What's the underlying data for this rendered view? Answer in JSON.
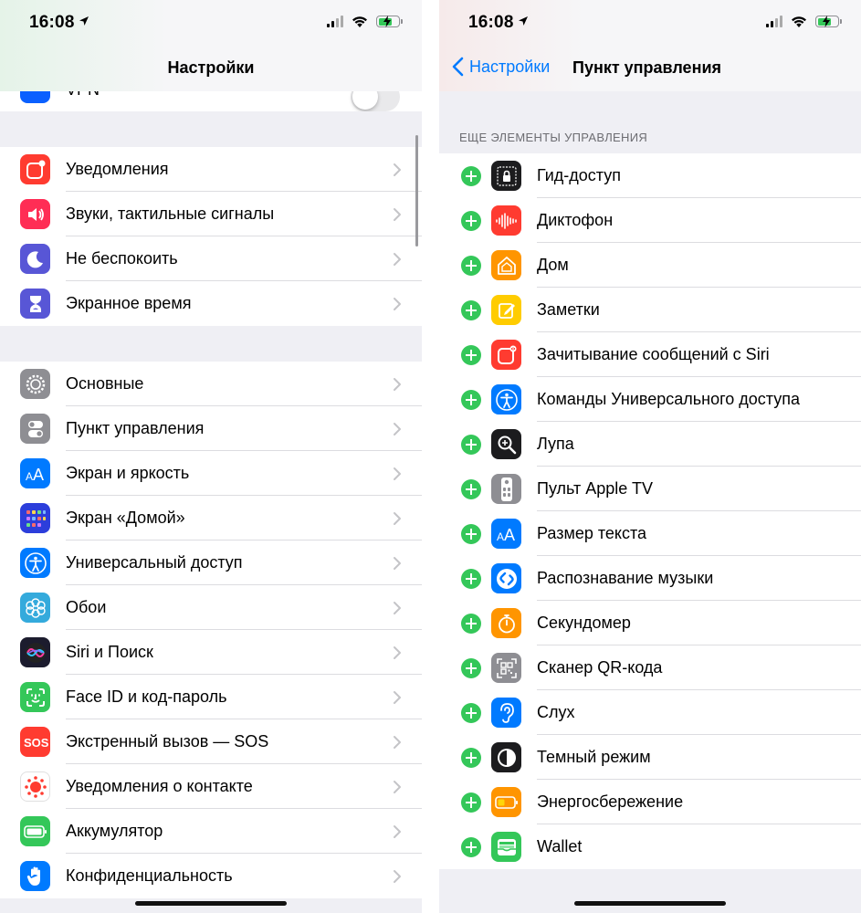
{
  "status": {
    "time": "16:08"
  },
  "left": {
    "title": "Настройки",
    "vpn_label": "VPN",
    "group1": [
      {
        "label": "Уведомления",
        "icon": "notifications-icon",
        "color": "#ff3b30"
      },
      {
        "label": "Звуки, тактильные сигналы",
        "icon": "sounds-icon",
        "color": "#ff2d55"
      },
      {
        "label": "Не беспокоить",
        "icon": "moon-icon",
        "color": "#5856d6"
      },
      {
        "label": "Экранное время",
        "icon": "hourglass-icon",
        "color": "#5856d6"
      }
    ],
    "group2": [
      {
        "label": "Основные",
        "icon": "gear-icon",
        "color": "#8e8e93"
      },
      {
        "label": "Пункт управления",
        "icon": "switches-icon",
        "color": "#8e8e93"
      },
      {
        "label": "Экран и яркость",
        "icon": "text-size-icon",
        "color": "#007aff"
      },
      {
        "label": "Экран «Домой»",
        "icon": "home-screen-icon",
        "color": "#2c3edb"
      },
      {
        "label": "Универсальный доступ",
        "icon": "accessibility-icon",
        "color": "#007aff"
      },
      {
        "label": "Обои",
        "icon": "wallpaper-icon",
        "color": "#34aadc"
      },
      {
        "label": "Siri и Поиск",
        "icon": "siri-icon",
        "color": "#1c1c2e"
      },
      {
        "label": "Face ID и код-пароль",
        "icon": "face-id-icon",
        "color": "#34c759"
      },
      {
        "label": "Экстренный вызов — SOS",
        "icon": "sos-icon",
        "color": "#ff3b30"
      },
      {
        "label": "Уведомления о контакте",
        "icon": "exposure-icon",
        "color": "#ffffff"
      },
      {
        "label": "Аккумулятор",
        "icon": "battery-icon",
        "color": "#34c759"
      },
      {
        "label": "Конфиденциальность",
        "icon": "hand-icon",
        "color": "#007aff"
      }
    ]
  },
  "right": {
    "back_label": "Настройки",
    "title": "Пункт управления",
    "section_header": "ЕЩЕ ЭЛЕМЕНТЫ УПРАВЛЕНИЯ",
    "controls": [
      {
        "label": "Гид-доступ",
        "icon": "lock-icon",
        "color": "#1c1c1e"
      },
      {
        "label": "Диктофон",
        "icon": "voice-memo-icon",
        "color": "#ff3b30"
      },
      {
        "label": "Дом",
        "icon": "home-icon",
        "color": "#ff9500"
      },
      {
        "label": "Заметки",
        "icon": "notes-icon",
        "color": "#ffcc00"
      },
      {
        "label": "Зачитывание сообщений с Siri",
        "icon": "announce-icon",
        "color": "#ff3b30"
      },
      {
        "label": "Команды Универсального доступа",
        "icon": "accessibility-icon",
        "color": "#007aff"
      },
      {
        "label": "Лупа",
        "icon": "magnifier-icon",
        "color": "#1c1c1e"
      },
      {
        "label": "Пульт Apple TV",
        "icon": "remote-icon",
        "color": "#8e8e93"
      },
      {
        "label": "Размер текста",
        "icon": "text-size-icon",
        "color": "#007aff"
      },
      {
        "label": "Распознавание музыки",
        "icon": "shazam-icon",
        "color": "#007aff"
      },
      {
        "label": "Секундомер",
        "icon": "stopwatch-icon",
        "color": "#ff9500"
      },
      {
        "label": "Сканер QR-кода",
        "icon": "qr-code-icon",
        "color": "#8e8e93"
      },
      {
        "label": "Слух",
        "icon": "ear-icon",
        "color": "#007aff"
      },
      {
        "label": "Темный режим",
        "icon": "dark-mode-icon",
        "color": "#1c1c1e"
      },
      {
        "label": "Энергосбережение",
        "icon": "low-power-icon",
        "color": "#ff9500"
      },
      {
        "label": "Wallet",
        "icon": "wallet-icon",
        "color": "#34c759"
      }
    ]
  }
}
